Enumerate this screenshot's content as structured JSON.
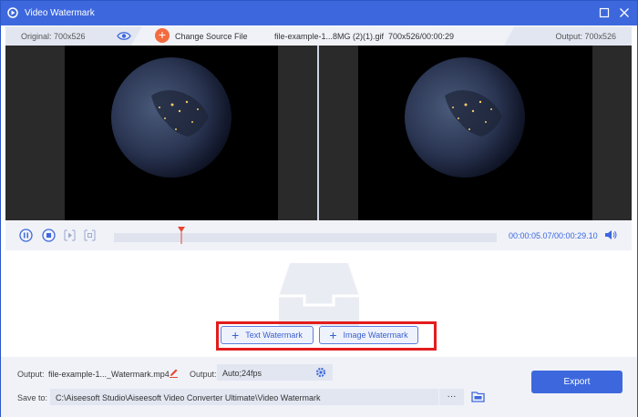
{
  "window": {
    "title": "Video Watermark",
    "accent_color": "#3d68dd"
  },
  "infobar": {
    "original_label": "Original: 700x526",
    "change_source_label": "Change Source File",
    "file_name": "file-example-1...8MG (2)(1).gif",
    "file_meta": "700x526/00:00:29",
    "output_label": "Output: 700x526"
  },
  "player": {
    "current_time": "00:00:05.07",
    "total_time": "/00:00:29.10",
    "progress": 0.175
  },
  "watermark": {
    "text_button": "Text Watermark",
    "image_button": "Image Watermark"
  },
  "bottom": {
    "output_label": "Output:",
    "output_file": "file-example-1..._Watermark.mp4",
    "output_format_label": "Output:",
    "output_format": "Auto;24fps",
    "save_to_label": "Save to:",
    "save_path": "C:\\Aiseesoft Studio\\Aiseesoft Video Converter Ultimate\\Video Watermark",
    "browse_label": "···",
    "export_label": "Export"
  }
}
